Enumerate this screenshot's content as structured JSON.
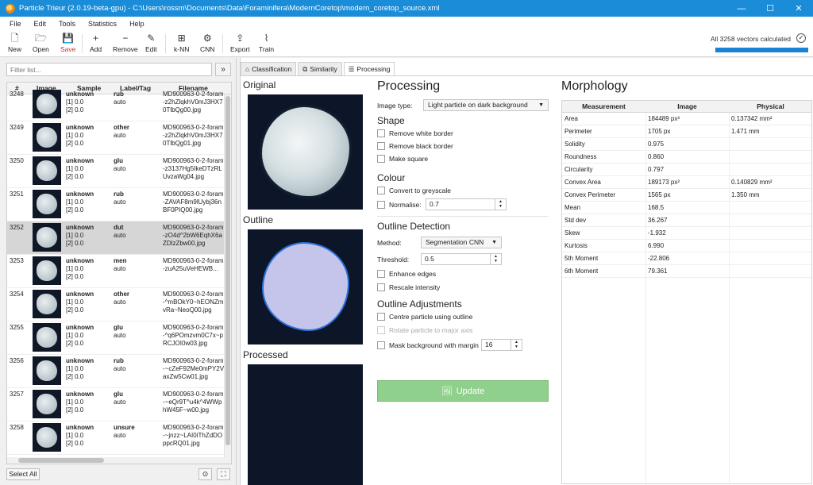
{
  "titlebar": {
    "title": "Particle Trieur (2.0.19-beta-gpu)  -  C:\\Users\\rossm\\Documents\\Data\\Foraminifera\\ModernCoretop\\modern_coretop_source.xml",
    "minimize": "—",
    "maximize": "☐",
    "close": "✕"
  },
  "menu": [
    "File",
    "Edit",
    "Tools",
    "Statistics",
    "Help"
  ],
  "toolbar": {
    "new": "New",
    "open": "Open",
    "save": "Save",
    "add": "Add",
    "remove": "Remove",
    "edit": "Edit",
    "knn": "k-NN",
    "cnn": "CNN",
    "export": "Export",
    "train": "Train",
    "status": "All 3258 vectors calculated",
    "progress": 1.0
  },
  "filter": {
    "placeholder": "Filter list...",
    "button": "»"
  },
  "list": {
    "headers": {
      "idx": "#",
      "image": "Image",
      "sample": "Sample",
      "label": "Label/Tag",
      "filename": "Filename"
    },
    "rows": [
      {
        "idx": "3248",
        "sample": "unknown",
        "s1": "[1] 0.0",
        "s2": "[2] 0.0",
        "label": "rub",
        "tag": "auto",
        "file": "MD900963-0-2-foram-z2hZlqkhV0mJ3HX70TlbQg00.jpg"
      },
      {
        "idx": "3249",
        "sample": "unknown",
        "s1": "[1] 0.0",
        "s2": "[2] 0.0",
        "label": "other",
        "tag": "auto",
        "file": "MD900963-0-2-foram-z2hZlqkhV0mJ3HX70TlbQg01.jpg"
      },
      {
        "idx": "3250",
        "sample": "unknown",
        "s1": "[1] 0.0",
        "s2": "[2] 0.0",
        "label": "glu",
        "tag": "auto",
        "file": "MD900963-0-2-foram-z3137Hg5IkeDTzRLUvzaWg04.jpg"
      },
      {
        "idx": "3251",
        "sample": "unknown",
        "s1": "[1] 0.0",
        "s2": "[2] 0.0",
        "label": "rub",
        "tag": "auto",
        "file": "MD900963-0-2-foram-ZAVAF8m9lUybj36nBF0PIQ00.jpg"
      },
      {
        "idx": "3252",
        "sample": "unknown",
        "s1": "[1] 0.0",
        "s2": "[2] 0.0",
        "label": "dut",
        "tag": "auto",
        "file": "MD900963-0-2-foram-zO4d^2bW6EqhX6aZDlzZbw00.jpg",
        "selected": true
      },
      {
        "idx": "3253",
        "sample": "unknown",
        "s1": "[1] 0.0",
        "s2": "[2] 0.0",
        "label": "men",
        "tag": "auto",
        "file": "MD900963-0-2-foram-zuA25uVeHEWB..."
      },
      {
        "idx": "3254",
        "sample": "unknown",
        "s1": "[1] 0.0",
        "s2": "[2] 0.0",
        "label": "other",
        "tag": "auto",
        "file": "MD900963-0-2-foram-^mBOkY0~hEONZmvRa~NeoQ00.jpg"
      },
      {
        "idx": "3255",
        "sample": "unknown",
        "s1": "[1] 0.0",
        "s2": "[2] 0.0",
        "label": "glu",
        "tag": "auto",
        "file": "MD900963-0-2-foram-^q6POmzvm0C7x~pRCJOI0w03.jpg"
      },
      {
        "idx": "3256",
        "sample": "unknown",
        "s1": "[1] 0.0",
        "s2": "[2] 0.0",
        "label": "rub",
        "tag": "auto",
        "file": "MD900963-0-2-foram-~cZeF92Me0mPY2VaxZw5Cw01.jpg"
      },
      {
        "idx": "3257",
        "sample": "unknown",
        "s1": "[1] 0.0",
        "s2": "[2] 0.0",
        "label": "glu",
        "tag": "auto",
        "file": "MD900963-0-2-foram-~eQr9T^u4k^4WWphW45F~w00.jpg"
      },
      {
        "idx": "3258",
        "sample": "unknown",
        "s1": "[1] 0.0",
        "s2": "[2] 0.0",
        "label": "unsure",
        "tag": "auto",
        "file": "MD900963-0-2-foram-~jnzz~LAI0iThZdDOppcRQ01.jpg"
      }
    ]
  },
  "bottom": {
    "select_all": "Select All"
  },
  "tabs": [
    "Classification",
    "Similarity",
    "Processing"
  ],
  "images": {
    "original": "Original",
    "outline": "Outline",
    "processed": "Processed"
  },
  "processing": {
    "title": "Processing",
    "image_type_label": "Image type:",
    "image_type": "Light particle on dark background",
    "shape": "Shape",
    "remove_white": "Remove white border",
    "remove_black": "Remove black border",
    "make_square": "Make square",
    "colour": "Colour",
    "greyscale": "Convert to greyscale",
    "normalise": "Normalise:",
    "normalise_value": "0.7",
    "outline_detection": "Outline Detection",
    "method_label": "Method:",
    "method": "Segmentation CNN",
    "threshold_label": "Threshold:",
    "threshold": "0.5",
    "enhance": "Enhance edges",
    "rescale": "Rescale intensity",
    "outline_adjust": "Outline Adjustments",
    "centre": "Centre particle using outline",
    "rotate": "Rotate particle to major axis",
    "mask": "Mask background with margin",
    "mask_value": "16",
    "update": "Update"
  },
  "morphology": {
    "title": "Morphology",
    "headers": [
      "Measurement",
      "Image",
      "Physical"
    ],
    "rows": [
      {
        "m": "Area",
        "img": "184489 px²",
        "phys": "0.137342 mm²"
      },
      {
        "m": "Perimeter",
        "img": "1705 px",
        "phys": "1.471 mm"
      },
      {
        "m": "Solidity",
        "img": "0.975",
        "phys": ""
      },
      {
        "m": "Roundness",
        "img": "0.860",
        "phys": ""
      },
      {
        "m": "Circularity",
        "img": "0.797",
        "phys": ""
      },
      {
        "m": "Convex Area",
        "img": "189173 px²",
        "phys": "0.140829 mm²"
      },
      {
        "m": "Convex Perimeter",
        "img": "1565 px",
        "phys": "1.350 mm"
      },
      {
        "m": "Mean",
        "img": "168.5",
        "phys": ""
      },
      {
        "m": "Std dev",
        "img": "36.267",
        "phys": ""
      },
      {
        "m": "Skew",
        "img": "-1.932",
        "phys": ""
      },
      {
        "m": "Kurtosis",
        "img": "6.990",
        "phys": ""
      },
      {
        "m": "5th Moment",
        "img": "-22.806",
        "phys": ""
      },
      {
        "m": "6th Moment",
        "img": "79.361",
        "phys": ""
      }
    ]
  }
}
